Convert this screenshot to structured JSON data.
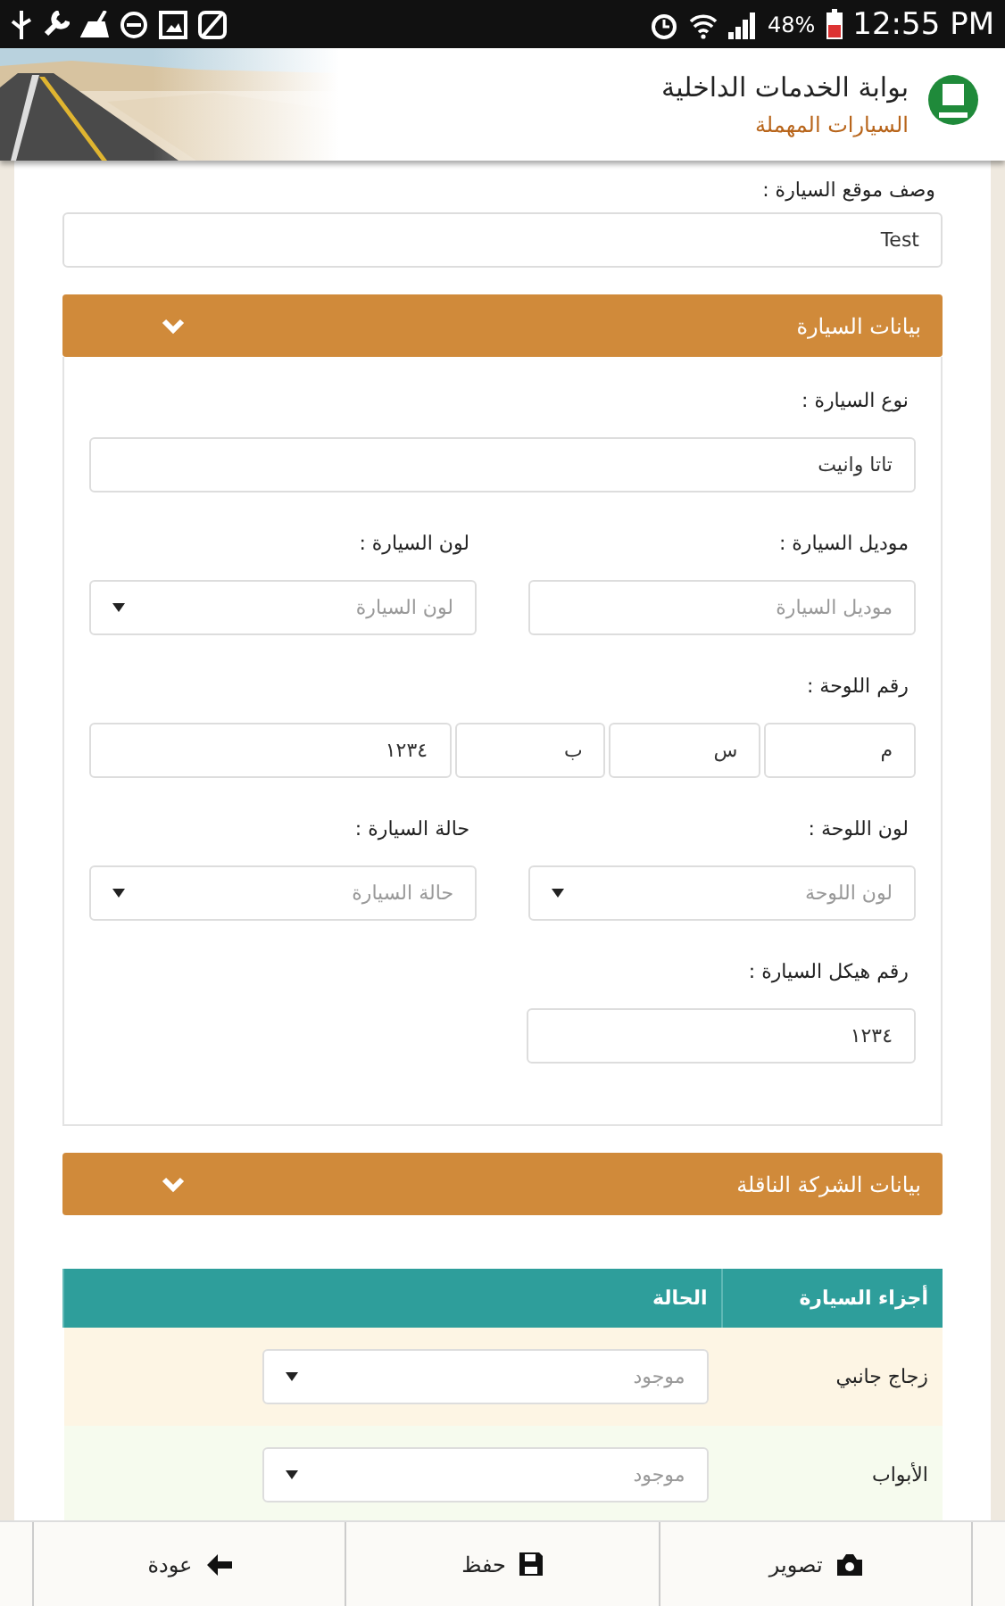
{
  "status_bar": {
    "battery": "48%",
    "time": "12:55 PM"
  },
  "header": {
    "title": "بوابة الخدمات الداخلية",
    "subtitle": "السيارات المهملة"
  },
  "location": {
    "label": "وصف موقع السيارة :",
    "value": "Test"
  },
  "sections": [
    {
      "title": "بيانات السيارة",
      "rows": [
        [
          {
            "kind": "text",
            "label": "نوع السيارة :",
            "value": "تاتا وانيت"
          }
        ],
        [
          {
            "kind": "text",
            "label": "موديل السيارة :",
            "placeholder": "موديل السيارة"
          },
          {
            "kind": "select",
            "label": "لون السيارة :",
            "placeholder": "لون السيارة"
          }
        ],
        [
          {
            "kind": "plate",
            "label": "رقم اللوحة :",
            "parts": [
              "م",
              "س",
              "ب",
              "١٢٣٤"
            ]
          }
        ],
        [
          {
            "kind": "select",
            "label": "لون اللوحة :",
            "placeholder": "لون اللوحة"
          },
          {
            "kind": "select",
            "label": "حالة السيارة :",
            "placeholder": "حالة السيارة"
          }
        ],
        [
          {
            "kind": "text",
            "label": "رقم هيكل السيارة :",
            "value": "١٢٣٤"
          }
        ]
      ]
    },
    {
      "title": "بيانات الشركة الناقلة"
    }
  ],
  "table": {
    "columns": [
      "أجزاء السيارة",
      "الحالة"
    ],
    "rows": [
      {
        "part": "زجاج جانبي",
        "status": "موجود"
      },
      {
        "part": "الأبواب",
        "status": "موجود"
      }
    ]
  },
  "actions": [
    {
      "kind": "camera",
      "label": "تصوير"
    },
    {
      "kind": "save",
      "label": "حفظ"
    },
    {
      "kind": "back",
      "label": "عودة"
    }
  ]
}
